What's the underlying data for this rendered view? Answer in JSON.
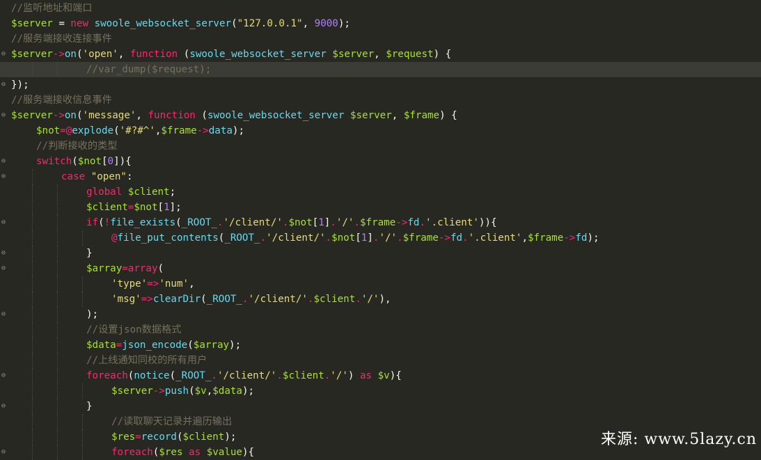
{
  "editor": {
    "theme": {
      "background": "#272822",
      "current_line": "#3b3c36",
      "comment": "#75715e",
      "variable": "#a6e22e",
      "keyword": "#f92672",
      "function": "#66d9ef",
      "string": "#e6db74",
      "number": "#ae81ff"
    },
    "lines": [
      {
        "fold": "",
        "hl": false,
        "indent": 0,
        "tokens": [
          [
            "cm",
            "//监听地址和端口"
          ]
        ]
      },
      {
        "fold": "",
        "hl": false,
        "indent": 0,
        "tokens": [
          [
            "var",
            "$server"
          ],
          [
            "pl",
            " = "
          ],
          [
            "kw",
            "new"
          ],
          [
            "pl",
            " "
          ],
          [
            "fn",
            "swoole_websocket_server"
          ],
          [
            "pl",
            "("
          ],
          [
            "str",
            "\"127.0.0.1\""
          ],
          [
            "pl",
            ", "
          ],
          [
            "num",
            "9000"
          ],
          [
            "pl",
            ");"
          ]
        ]
      },
      {
        "fold": "",
        "hl": false,
        "indent": 0,
        "tokens": [
          [
            "cm",
            "//服务端接收连接事件"
          ]
        ]
      },
      {
        "fold": "⊖",
        "hl": false,
        "indent": 0,
        "tokens": [
          [
            "var",
            "$server"
          ],
          [
            "op",
            "->"
          ],
          [
            "fn",
            "on"
          ],
          [
            "pl",
            "("
          ],
          [
            "str",
            "'open'"
          ],
          [
            "pl",
            ", "
          ],
          [
            "kw",
            "function"
          ],
          [
            "pl",
            " ("
          ],
          [
            "fn",
            "swoole_websocket_server"
          ],
          [
            "pl",
            " "
          ],
          [
            "var",
            "$server"
          ],
          [
            "pl",
            ", "
          ],
          [
            "var",
            "$request"
          ],
          [
            "pl",
            ") {"
          ]
        ]
      },
      {
        "fold": "",
        "hl": true,
        "indent": 3,
        "tokens": [
          [
            "cm",
            "//var_dump($request);"
          ]
        ]
      },
      {
        "fold": "⊖",
        "hl": false,
        "indent": 0,
        "tokens": [
          [
            "pl",
            "});"
          ]
        ]
      },
      {
        "fold": "",
        "hl": false,
        "indent": 0,
        "tokens": [
          [
            "cm",
            "//服务端接收信息事件"
          ]
        ]
      },
      {
        "fold": "⊖",
        "hl": false,
        "indent": 0,
        "tokens": [
          [
            "var",
            "$server"
          ],
          [
            "op",
            "->"
          ],
          [
            "fn",
            "on"
          ],
          [
            "pl",
            "("
          ],
          [
            "str",
            "'message'"
          ],
          [
            "pl",
            ", "
          ],
          [
            "kw",
            "function"
          ],
          [
            "pl",
            " ("
          ],
          [
            "fn",
            "swoole_websocket_server"
          ],
          [
            "pl",
            " "
          ],
          [
            "var",
            "$server"
          ],
          [
            "pl",
            ", "
          ],
          [
            "var",
            "$frame"
          ],
          [
            "pl",
            ") {"
          ]
        ]
      },
      {
        "fold": "",
        "hl": false,
        "indent": 1,
        "tokens": [
          [
            "var",
            "$not"
          ],
          [
            "op",
            "=@"
          ],
          [
            "fn",
            "explode"
          ],
          [
            "pl",
            "("
          ],
          [
            "str",
            "'#?#^'"
          ],
          [
            "pl",
            ","
          ],
          [
            "var",
            "$frame"
          ],
          [
            "op",
            "->"
          ],
          [
            "fn",
            "data"
          ],
          [
            "pl",
            ");"
          ]
        ]
      },
      {
        "fold": "",
        "hl": false,
        "indent": 1,
        "tokens": [
          [
            "cm",
            "//判断接收的类型"
          ]
        ]
      },
      {
        "fold": "⊖",
        "hl": false,
        "indent": 1,
        "tokens": [
          [
            "kw",
            "switch"
          ],
          [
            "pl",
            "("
          ],
          [
            "var",
            "$not"
          ],
          [
            "pl",
            "["
          ],
          [
            "num",
            "0"
          ],
          [
            "pl",
            "]){"
          ]
        ]
      },
      {
        "fold": "⊖",
        "hl": false,
        "indent": 2,
        "tokens": [
          [
            "kw",
            "case"
          ],
          [
            "pl",
            " "
          ],
          [
            "str",
            "\"open\""
          ],
          [
            "pl",
            ":"
          ]
        ]
      },
      {
        "fold": "",
        "hl": false,
        "indent": 3,
        "tokens": [
          [
            "kw",
            "global"
          ],
          [
            "pl",
            " "
          ],
          [
            "var",
            "$client"
          ],
          [
            "pl",
            ";"
          ]
        ]
      },
      {
        "fold": "",
        "hl": false,
        "indent": 3,
        "tokens": [
          [
            "var",
            "$client"
          ],
          [
            "op",
            "="
          ],
          [
            "var",
            "$not"
          ],
          [
            "pl",
            "["
          ],
          [
            "num",
            "1"
          ],
          [
            "pl",
            "];"
          ]
        ]
      },
      {
        "fold": "⊖",
        "hl": false,
        "indent": 3,
        "tokens": [
          [
            "kw",
            "if"
          ],
          [
            "pl",
            "("
          ],
          [
            "op",
            "!"
          ],
          [
            "fn",
            "file_exists"
          ],
          [
            "pl",
            "("
          ],
          [
            "fn",
            "_ROOT_"
          ],
          [
            "op",
            "."
          ],
          [
            "str",
            "'/client/'"
          ],
          [
            "op",
            "."
          ],
          [
            "var",
            "$not"
          ],
          [
            "pl",
            "["
          ],
          [
            "num",
            "1"
          ],
          [
            "pl",
            "]"
          ],
          [
            "op",
            "."
          ],
          [
            "str",
            "'/'"
          ],
          [
            "op",
            "."
          ],
          [
            "var",
            "$frame"
          ],
          [
            "op",
            "->"
          ],
          [
            "fn",
            "fd"
          ],
          [
            "op",
            "."
          ],
          [
            "str",
            "'.client'"
          ],
          [
            "pl",
            ")){"
          ]
        ]
      },
      {
        "fold": "",
        "hl": false,
        "indent": 4,
        "tokens": [
          [
            "op",
            "@"
          ],
          [
            "fn",
            "file_put_contents"
          ],
          [
            "pl",
            "("
          ],
          [
            "fn",
            "_ROOT_"
          ],
          [
            "op",
            "."
          ],
          [
            "str",
            "'/client/'"
          ],
          [
            "op",
            "."
          ],
          [
            "var",
            "$not"
          ],
          [
            "pl",
            "["
          ],
          [
            "num",
            "1"
          ],
          [
            "pl",
            "]"
          ],
          [
            "op",
            "."
          ],
          [
            "str",
            "'/'"
          ],
          [
            "op",
            "."
          ],
          [
            "var",
            "$frame"
          ],
          [
            "op",
            "->"
          ],
          [
            "fn",
            "fd"
          ],
          [
            "op",
            "."
          ],
          [
            "str",
            "'.client'"
          ],
          [
            "pl",
            ","
          ],
          [
            "var",
            "$frame"
          ],
          [
            "op",
            "->"
          ],
          [
            "fn",
            "fd"
          ],
          [
            "pl",
            ");"
          ]
        ]
      },
      {
        "fold": "⊖",
        "hl": false,
        "indent": 3,
        "tokens": [
          [
            "pl",
            "}"
          ]
        ]
      },
      {
        "fold": "⊖",
        "hl": false,
        "indent": 3,
        "tokens": [
          [
            "var",
            "$array"
          ],
          [
            "op",
            "="
          ],
          [
            "kw",
            "array"
          ],
          [
            "pl",
            "("
          ]
        ]
      },
      {
        "fold": "",
        "hl": false,
        "indent": 4,
        "tokens": [
          [
            "str",
            "'type'"
          ],
          [
            "op",
            "=>"
          ],
          [
            "str",
            "'num'"
          ],
          [
            "pl",
            ","
          ]
        ]
      },
      {
        "fold": "",
        "hl": false,
        "indent": 4,
        "tokens": [
          [
            "str",
            "'msg'"
          ],
          [
            "op",
            "=>"
          ],
          [
            "fn",
            "clearDir"
          ],
          [
            "pl",
            "("
          ],
          [
            "fn",
            "_ROOT_"
          ],
          [
            "op",
            "."
          ],
          [
            "str",
            "'/client/'"
          ],
          [
            "op",
            "."
          ],
          [
            "var",
            "$client"
          ],
          [
            "op",
            "."
          ],
          [
            "str",
            "'/'"
          ],
          [
            "pl",
            "),"
          ]
        ]
      },
      {
        "fold": "⊖",
        "hl": false,
        "indent": 3,
        "tokens": [
          [
            "pl",
            ");"
          ]
        ]
      },
      {
        "fold": "",
        "hl": false,
        "indent": 3,
        "tokens": [
          [
            "cm",
            "//设置json数据格式"
          ]
        ]
      },
      {
        "fold": "",
        "hl": false,
        "indent": 3,
        "tokens": [
          [
            "var",
            "$data"
          ],
          [
            "op",
            "="
          ],
          [
            "fn",
            "json_encode"
          ],
          [
            "pl",
            "("
          ],
          [
            "var",
            "$array"
          ],
          [
            "pl",
            ");"
          ]
        ]
      },
      {
        "fold": "",
        "hl": false,
        "indent": 3,
        "tokens": [
          [
            "cm",
            "//上线通知同校的所有用户"
          ]
        ]
      },
      {
        "fold": "⊖",
        "hl": false,
        "indent": 3,
        "tokens": [
          [
            "kw",
            "foreach"
          ],
          [
            "pl",
            "("
          ],
          [
            "fn",
            "notice"
          ],
          [
            "pl",
            "("
          ],
          [
            "fn",
            "_ROOT_"
          ],
          [
            "op",
            "."
          ],
          [
            "str",
            "'/client/'"
          ],
          [
            "op",
            "."
          ],
          [
            "var",
            "$client"
          ],
          [
            "op",
            "."
          ],
          [
            "str",
            "'/'"
          ],
          [
            "pl",
            ") "
          ],
          [
            "kw",
            "as"
          ],
          [
            "pl",
            " "
          ],
          [
            "var",
            "$v"
          ],
          [
            "pl",
            "){"
          ]
        ]
      },
      {
        "fold": "",
        "hl": false,
        "indent": 4,
        "tokens": [
          [
            "var",
            "$server"
          ],
          [
            "op",
            "->"
          ],
          [
            "fn",
            "push"
          ],
          [
            "pl",
            "("
          ],
          [
            "var",
            "$v"
          ],
          [
            "pl",
            ","
          ],
          [
            "var",
            "$data"
          ],
          [
            "pl",
            ");"
          ]
        ]
      },
      {
        "fold": "⊖",
        "hl": false,
        "indent": 3,
        "tokens": [
          [
            "pl",
            "}"
          ]
        ]
      },
      {
        "fold": "",
        "hl": false,
        "indent": 4,
        "tokens": [
          [
            "cm",
            "//读取聊天记录并遍历输出"
          ]
        ]
      },
      {
        "fold": "",
        "hl": false,
        "indent": 4,
        "tokens": [
          [
            "var",
            "$res"
          ],
          [
            "op",
            "="
          ],
          [
            "fn",
            "record"
          ],
          [
            "pl",
            "("
          ],
          [
            "var",
            "$client"
          ],
          [
            "pl",
            ");"
          ]
        ]
      },
      {
        "fold": "⊖",
        "hl": false,
        "indent": 4,
        "tokens": [
          [
            "kw",
            "foreach"
          ],
          [
            "pl",
            "("
          ],
          [
            "var",
            "$res"
          ],
          [
            "pl",
            " "
          ],
          [
            "kw",
            "as"
          ],
          [
            "pl",
            " "
          ],
          [
            "var",
            "$value"
          ],
          [
            "pl",
            "){"
          ]
        ]
      }
    ]
  },
  "watermark": {
    "text": "来源: www.5lazy.cn"
  }
}
